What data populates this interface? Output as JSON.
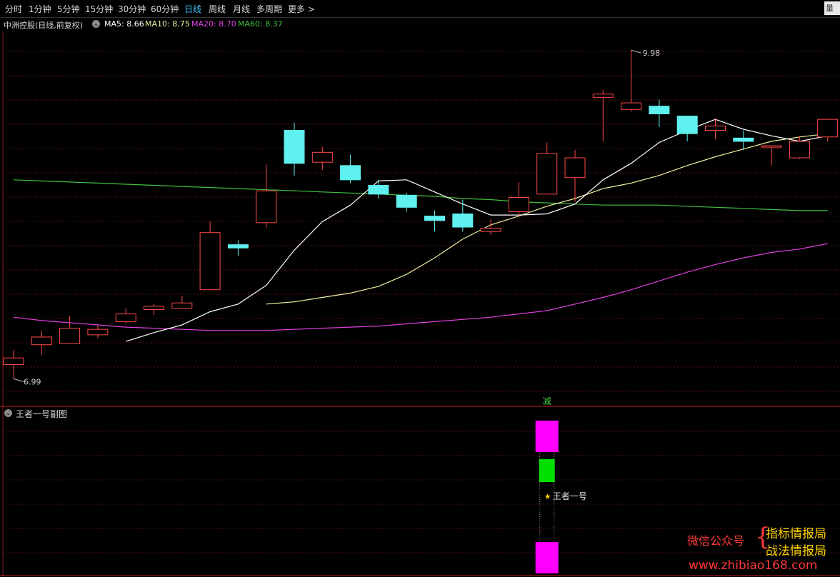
{
  "toolbar": {
    "periods": [
      "分时",
      "1分钟",
      "5分钟",
      "15分钟",
      "30分钟",
      "60分钟",
      "日线",
      "周线",
      "月线",
      "多周期",
      "更多 >"
    ],
    "active": "日线",
    "corner_label": "量"
  },
  "info": {
    "stock_title": "中洲控股(日线,前复权)",
    "ma5": "MA5: 8.66",
    "ma10": "MA10: 8.75",
    "ma20": "MA20: 8.70",
    "ma60": "MA60: 8.37"
  },
  "colors": {
    "up": "#ff4a4a",
    "down": "#5ff0f0",
    "ma5": "#ffffff",
    "ma10": "#f0f0a0",
    "ma20": "#e040e0",
    "ma60": "#40c040",
    "active_tab": "#3fc6ff",
    "magenta_bar": "#ff00ff",
    "green_bar": "#00e000"
  },
  "chart_data": {
    "type": "candlestick",
    "price_range": [
      6.85,
      10.15
    ],
    "high_label": "9.98",
    "low_label": "6.99",
    "reduce_marker": "减",
    "candles": [
      {
        "o": 7.18,
        "c": 7.12,
        "h": 7.25,
        "l": 6.99,
        "dir": "up"
      },
      {
        "o": 7.3,
        "c": 7.37,
        "h": 7.43,
        "l": 7.21,
        "dir": "up"
      },
      {
        "o": 7.31,
        "c": 7.45,
        "h": 7.56,
        "l": 7.31,
        "dir": "up"
      },
      {
        "o": 7.39,
        "c": 7.44,
        "h": 7.48,
        "l": 7.36,
        "dir": "up"
      },
      {
        "o": 7.51,
        "c": 7.58,
        "h": 7.63,
        "l": 7.49,
        "dir": "up"
      },
      {
        "o": 7.62,
        "c": 7.65,
        "h": 7.67,
        "l": 7.57,
        "dir": "up"
      },
      {
        "o": 7.63,
        "c": 7.68,
        "h": 7.74,
        "l": 7.63,
        "dir": "up"
      },
      {
        "o": 7.8,
        "c": 8.32,
        "h": 8.42,
        "l": 7.8,
        "dir": "up"
      },
      {
        "o": 8.21,
        "c": 8.18,
        "h": 8.25,
        "l": 8.11,
        "dir": "down"
      },
      {
        "o": 8.41,
        "c": 8.7,
        "h": 8.94,
        "l": 8.36,
        "dir": "up"
      },
      {
        "o": 9.25,
        "c": 8.95,
        "h": 9.32,
        "l": 8.84,
        "dir": "down"
      },
      {
        "o": 8.96,
        "c": 9.05,
        "h": 9.1,
        "l": 8.89,
        "dir": "up"
      },
      {
        "o": 8.93,
        "c": 8.8,
        "h": 9.03,
        "l": 8.77,
        "dir": "down"
      },
      {
        "o": 8.75,
        "c": 8.67,
        "h": 8.8,
        "l": 8.63,
        "dir": "down"
      },
      {
        "o": 8.66,
        "c": 8.55,
        "h": 8.68,
        "l": 8.51,
        "dir": "down"
      },
      {
        "o": 8.47,
        "c": 8.43,
        "h": 8.52,
        "l": 8.33,
        "dir": "down"
      },
      {
        "o": 8.49,
        "c": 8.37,
        "h": 8.62,
        "l": 8.33,
        "dir": "down"
      },
      {
        "o": 8.33,
        "c": 8.36,
        "h": 8.44,
        "l": 8.3,
        "dir": "up"
      },
      {
        "o": 8.51,
        "c": 8.64,
        "h": 8.78,
        "l": 8.47,
        "dir": "up"
      },
      {
        "o": 8.67,
        "c": 9.04,
        "h": 9.14,
        "l": 8.67,
        "dir": "up"
      },
      {
        "o": 8.82,
        "c": 9.0,
        "h": 9.07,
        "l": 8.6,
        "dir": "up"
      },
      {
        "o": 9.58,
        "c": 9.55,
        "h": 9.62,
        "l": 9.15,
        "dir": "up"
      },
      {
        "o": 9.44,
        "c": 9.5,
        "h": 9.98,
        "l": 9.42,
        "dir": "up"
      },
      {
        "o": 9.47,
        "c": 9.4,
        "h": 9.53,
        "l": 9.28,
        "dir": "down"
      },
      {
        "o": 9.38,
        "c": 9.22,
        "h": 9.38,
        "l": 9.15,
        "dir": "down"
      },
      {
        "o": 9.25,
        "c": 9.29,
        "h": 9.36,
        "l": 9.17,
        "dir": "up"
      },
      {
        "o": 9.18,
        "c": 9.15,
        "h": 9.25,
        "l": 9.07,
        "dir": "down"
      },
      {
        "o": 9.11,
        "c": 9.1,
        "h": 9.11,
        "l": 8.93,
        "dir": "up"
      },
      {
        "o": 9.0,
        "c": 9.15,
        "h": 9.2,
        "l": 8.99,
        "dir": "up"
      },
      {
        "o": 9.19,
        "c": 9.35,
        "h": 9.35,
        "l": 9.15,
        "dir": "up"
      }
    ],
    "ma5": [
      null,
      null,
      null,
      null,
      7.33,
      7.41,
      7.48,
      7.6,
      7.67,
      7.84,
      8.16,
      8.42,
      8.57,
      8.79,
      8.8,
      8.69,
      8.58,
      8.48,
      8.48,
      8.49,
      8.58,
      8.8,
      8.95,
      9.14,
      9.25,
      9.35,
      9.26,
      9.2,
      9.15,
      9.2
    ],
    "ma10": [
      null,
      null,
      null,
      null,
      null,
      null,
      null,
      null,
      null,
      7.67,
      7.69,
      7.73,
      7.77,
      7.83,
      7.94,
      8.09,
      8.26,
      8.39,
      8.47,
      8.56,
      8.63,
      8.72,
      8.77,
      8.84,
      8.93,
      9.01,
      9.08,
      9.15,
      9.19,
      9.22
    ],
    "ma20": [
      7.55,
      7.52,
      7.5,
      7.48,
      7.46,
      7.45,
      7.44,
      7.43,
      7.43,
      7.43,
      7.44,
      7.45,
      7.46,
      7.47,
      7.49,
      7.51,
      7.53,
      7.55,
      7.58,
      7.61,
      7.67,
      7.73,
      7.8,
      7.88,
      7.96,
      8.03,
      8.09,
      8.14,
      8.17,
      8.22
    ],
    "ma60": [
      8.8,
      8.79,
      8.78,
      8.77,
      8.76,
      8.75,
      8.74,
      8.73,
      8.72,
      8.71,
      8.7,
      8.69,
      8.68,
      8.67,
      8.66,
      8.65,
      8.63,
      8.62,
      8.6,
      8.59,
      8.58,
      8.57,
      8.57,
      8.57,
      8.56,
      8.55,
      8.54,
      8.53,
      8.52,
      8.52
    ]
  },
  "subchart": {
    "title": "王者一号副图",
    "signal_label": "王者一号",
    "star": "★",
    "signal_index": 19
  },
  "watermark": {
    "left": "微信公众号",
    "brace": "{",
    "right1": "指标情报局",
    "right2": "战法情报局",
    "url": "www.zhibiao168.com"
  }
}
